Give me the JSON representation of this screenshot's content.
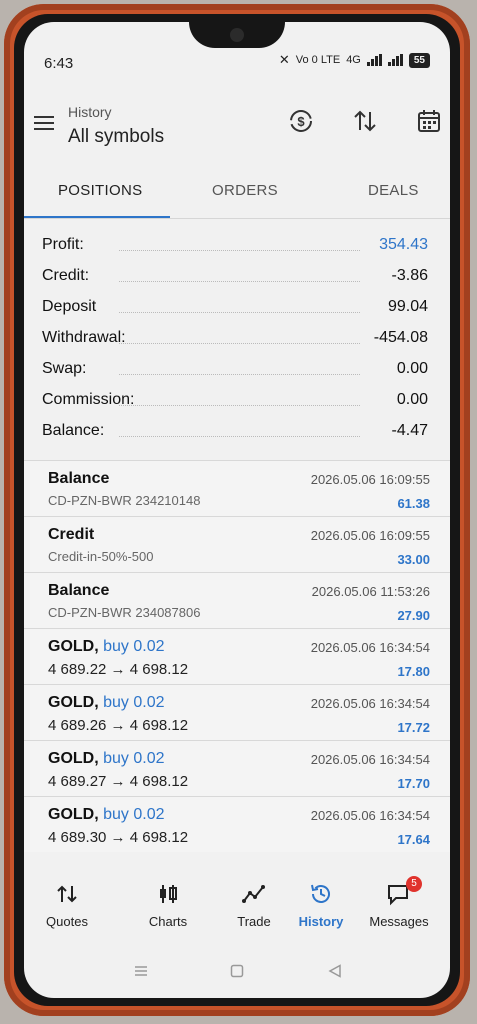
{
  "status": {
    "time": "6:43",
    "network_label": "Vo 0 LTE",
    "network_speed": "4G",
    "battery": "55"
  },
  "appbar": {
    "subtitle": "History",
    "title": "All symbols"
  },
  "tabs": [
    {
      "label": "POSITIONS",
      "active": true
    },
    {
      "label": "ORDERS",
      "active": false
    },
    {
      "label": "DEALS",
      "active": false
    }
  ],
  "summary": [
    {
      "label": "Profit:",
      "value": "354.43"
    },
    {
      "label": "Credit:",
      "value": "-3.86"
    },
    {
      "label": "Deposit",
      "value": "99.04"
    },
    {
      "label": "Withdrawal:",
      "value": "-454.08"
    },
    {
      "label": "Swap:",
      "value": "0.00"
    },
    {
      "label": "Commission:",
      "value": "0.00"
    },
    {
      "label": "Balance:",
      "value": "-4.47"
    }
  ],
  "deals": [
    {
      "title": "Balance",
      "action": "",
      "sub": "CD-PZN-BWR 234210148",
      "date": "2026.05.06 16:09:55",
      "amount": "61.38"
    },
    {
      "title": "Credit",
      "action": "",
      "sub": "Credit-in-50%-500",
      "date": "2026.05.06 16:09:55",
      "amount": "33.00"
    },
    {
      "title": "Balance",
      "action": "",
      "sub": "CD-PZN-BWR 234087806",
      "date": "2026.05.06 11:53:26",
      "amount": "27.90"
    },
    {
      "title": "GOLD,",
      "action": "buy 0.02",
      "sub": "4 689.22 → 4 698.12",
      "date": "2026.05.06 16:34:54",
      "amount": "17.80"
    },
    {
      "title": "GOLD,",
      "action": "buy 0.02",
      "sub": "4 689.26 → 4 698.12",
      "date": "2026.05.06 16:34:54",
      "amount": "17.72"
    },
    {
      "title": "GOLD,",
      "action": "buy 0.02",
      "sub": "4 689.27 → 4 698.12",
      "date": "2026.05.06 16:34:54",
      "amount": "17.70"
    },
    {
      "title": "GOLD,",
      "action": "buy 0.02",
      "sub": "4 689.30 → 4 698.12",
      "date": "2026.05.06 16:34:54",
      "amount": "17.64"
    }
  ],
  "bottomnav": [
    {
      "label": "Quotes",
      "icon": "quotes-icon"
    },
    {
      "label": "Charts",
      "icon": "charts-icon"
    },
    {
      "label": "Trade",
      "icon": "trade-icon"
    },
    {
      "label": "History",
      "icon": "history-icon",
      "active": true
    },
    {
      "label": "Messages",
      "icon": "messages-icon",
      "badge": "5"
    }
  ],
  "colors": {
    "accent": "#2e75c9",
    "badge": "#e0332d"
  }
}
